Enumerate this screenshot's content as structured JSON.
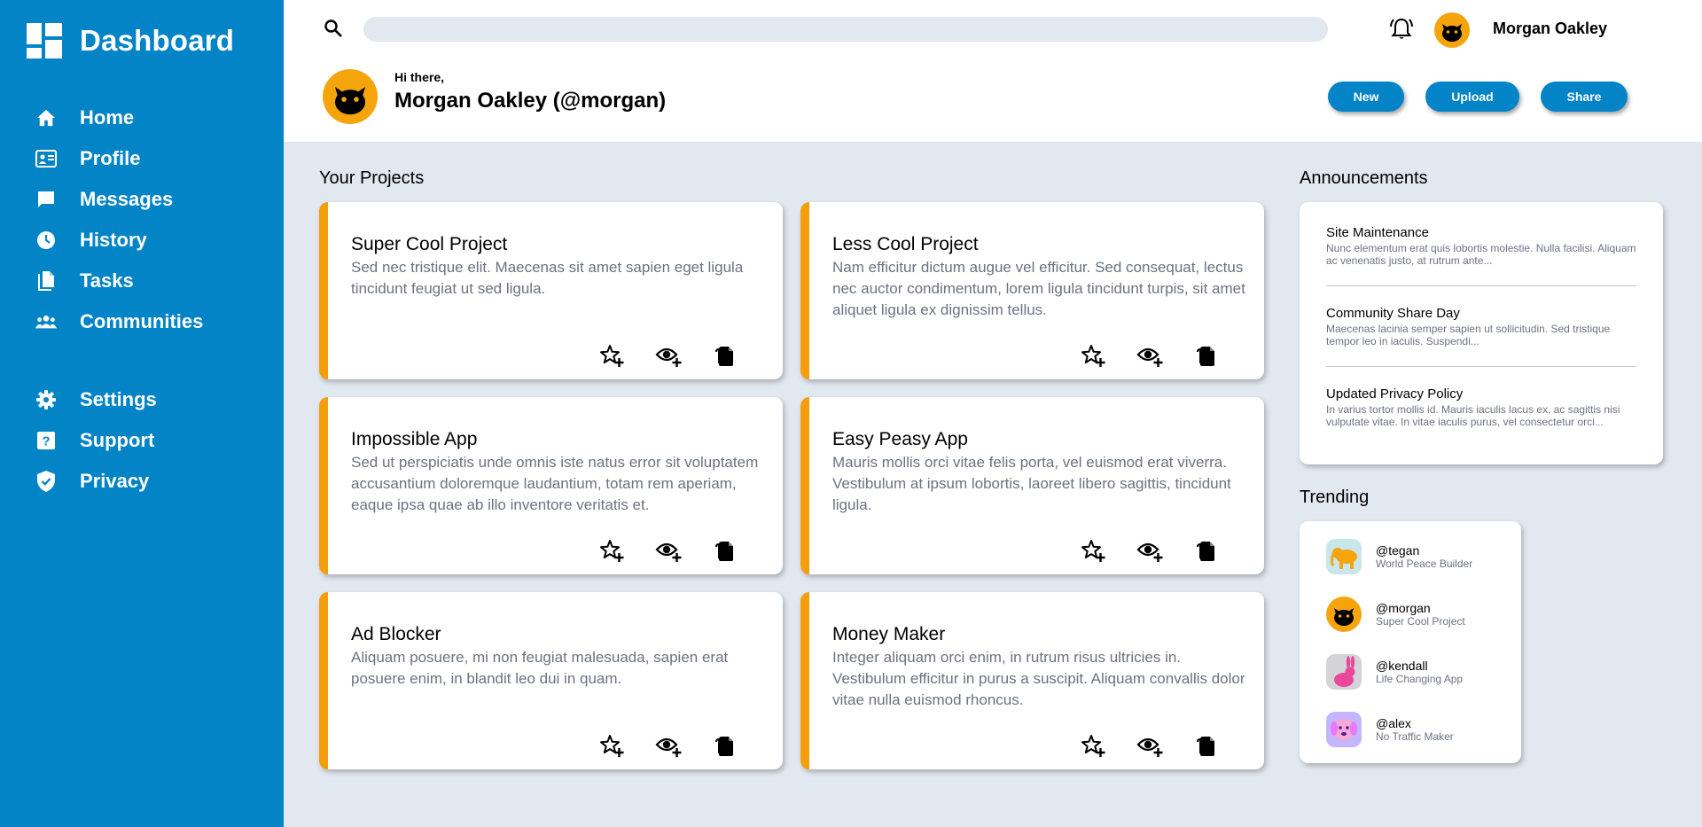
{
  "sidebar": {
    "brand": "Dashboard",
    "items": [
      {
        "label": "Home",
        "icon": "home-icon"
      },
      {
        "label": "Profile",
        "icon": "profile-card-icon"
      },
      {
        "label": "Messages",
        "icon": "message-icon"
      },
      {
        "label": "History",
        "icon": "clock-icon"
      },
      {
        "label": "Tasks",
        "icon": "document-icon"
      },
      {
        "label": "Communities",
        "icon": "people-icon"
      }
    ],
    "secondary": [
      {
        "label": "Settings",
        "icon": "gear-icon"
      },
      {
        "label": "Support",
        "icon": "help-icon"
      },
      {
        "label": "Privacy",
        "icon": "shield-icon"
      }
    ]
  },
  "header": {
    "search_placeholder": "",
    "username": "Morgan Oakley",
    "greeting": "Hi there,",
    "full_name": "Morgan Oakley (@morgan)",
    "buttons": {
      "new": "New",
      "upload": "Upload",
      "share": "Share"
    }
  },
  "projects": {
    "title": "Your Projects",
    "items": [
      {
        "title": "Super Cool Project",
        "desc": "Sed nec tristique elit. Maecenas sit amet sapien eget ligula tincidunt feugiat ut sed ligula."
      },
      {
        "title": "Less Cool Project",
        "desc": "Nam efficitur dictum augue vel efficitur. Sed consequat, lectus nec auctor condimentum, lorem ligula tincidunt turpis, sit amet aliquet ligula ex dignissim tellus."
      },
      {
        "title": "Impossible App",
        "desc": "Sed ut perspiciatis unde omnis iste natus error sit voluptatem accusantium doloremque laudantium, totam rem aperiam, eaque ipsa quae ab illo inventore veritatis et."
      },
      {
        "title": "Easy Peasy App",
        "desc": "Mauris mollis orci vitae felis porta, vel euismod erat viverra. Vestibulum at ipsum lobortis, laoreet libero sagittis, tincidunt ligula."
      },
      {
        "title": "Ad Blocker",
        "desc": "Aliquam posuere, mi non feugiat malesuada, sapien erat posuere enim, in blandit leo dui in quam."
      },
      {
        "title": "Money Maker",
        "desc": "Integer aliquam orci enim, in rutrum risus ultricies in. Vestibulum efficitur in purus a suscipit. Aliquam convallis dolor vitae nulla euismod rhoncus."
      }
    ]
  },
  "announcements": {
    "title": "Announcements",
    "items": [
      {
        "title": "Site Maintenance",
        "body": "Nunc elementum erat quis lobortis molestie. Nulla facilisi. Aliquam ac venenatis justo, at rutrum ante..."
      },
      {
        "title": "Community Share Day",
        "body": "Maecenas lacinia semper sapien ut sollicitudin. Sed tristique tempor leo in iaculis. Suspendi..."
      },
      {
        "title": "Updated Privacy Policy",
        "body": "In varius tortor mollis id. Mauris iaculis lacus ex, ac sagittis nisi vulputate vitae. In vitae iaculis purus, vel consectetur orci..."
      }
    ]
  },
  "trending": {
    "title": "Trending",
    "items": [
      {
        "handle": "@tegan",
        "project": "World Peace Builder",
        "avatar": "elephant-avatar"
      },
      {
        "handle": "@morgan",
        "project": "Super Cool Project",
        "avatar": "cat-avatar"
      },
      {
        "handle": "@kendall",
        "project": "Life Changing App",
        "avatar": "rabbit-avatar"
      },
      {
        "handle": "@alex",
        "project": "No Traffic Maker",
        "avatar": "dog-avatar"
      }
    ]
  },
  "colors": {
    "primary": "#0284c7",
    "accent": "#f59e0b",
    "background": "#e2e8f0",
    "muted_text": "#6b7280"
  }
}
